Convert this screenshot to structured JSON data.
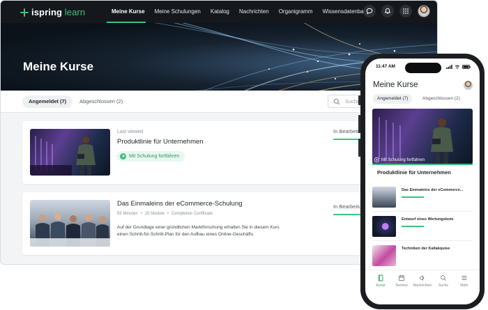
{
  "brand": {
    "name_a": "ispring",
    "name_b": "learn",
    "accent": "#3ec27b",
    "nav_bg": "#14181c"
  },
  "nav": {
    "items": [
      {
        "label": "Meine Kurse",
        "active": true
      },
      {
        "label": "Meine Schulungen",
        "active": false
      },
      {
        "label": "Katalog",
        "active": false
      },
      {
        "label": "Nachrichten",
        "active": false
      },
      {
        "label": "Organigramm",
        "active": false
      },
      {
        "label": "Wissensdatenbank",
        "active": false
      }
    ],
    "icons": [
      "chat-icon",
      "bell-icon",
      "apps-grid-icon"
    ]
  },
  "page": {
    "title": "Meine Kurse"
  },
  "tabs": [
    {
      "label": "Angemeldet (7)",
      "active": true
    },
    {
      "label": "Abgeschlossen (2)",
      "active": false
    }
  ],
  "search": {
    "placeholder": "Suchen"
  },
  "courses": [
    {
      "subtitle": "Last viewed",
      "title": "Produktlinie für Unternehmen",
      "button": "Mit Schulung fortfahren",
      "status": "In Bearbeitung"
    },
    {
      "title": "Das Einmaleins der eCommerce-Schulung",
      "meta": [
        "55 Minuten",
        "25 Module",
        "Completion Certificate"
      ],
      "description": "Auf der Grundlage einer gründlichen Marktforschung erhalten Sie in diesem Kurs einen Schritt-für-Schritt-Plan für den Aufbau eines Online-Geschäfts.",
      "status": "In Bearbeitung"
    }
  ],
  "phone": {
    "time": "11:47 AM",
    "title": "Meine Kurse",
    "tabs": [
      {
        "label": "Angemeldet (7)",
        "active": true
      },
      {
        "label": "Abgeschlossen (2)",
        "active": false
      }
    ],
    "hero": {
      "button": "Mit Schulung fortfahren",
      "title": "Produktlinie für Unternehmen"
    },
    "items": [
      {
        "title": "Das Einmaleins der eCommerce..."
      },
      {
        "title": "Entwurf eines Wertungsbots"
      },
      {
        "title": "Techniken der Kaltakquise"
      }
    ],
    "tabbar": [
      {
        "label": "Kurse",
        "icon": "book-icon",
        "active": true
      },
      {
        "label": "Termine",
        "icon": "calendar-icon",
        "active": false
      },
      {
        "label": "Nachrichten",
        "icon": "megaphone-icon",
        "active": false
      },
      {
        "label": "Suche",
        "icon": "search-icon",
        "active": false
      },
      {
        "label": "Mehr",
        "icon": "menu-icon",
        "active": false
      }
    ]
  }
}
